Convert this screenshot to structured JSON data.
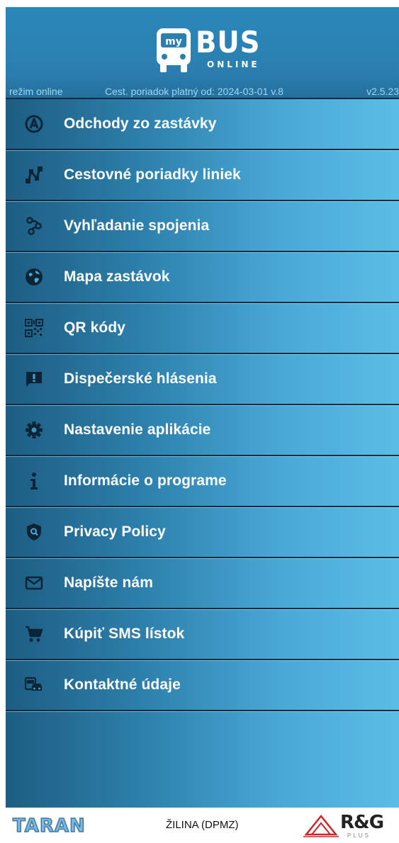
{
  "header": {
    "logo_word": "BUS",
    "logo_badge": "my",
    "logo_sub": "ONLINE",
    "mode": "režim online",
    "timetable_validity": "Cest. poriadok platný od: 2024-03-01 v.8",
    "version": "v2.5.23"
  },
  "menu": {
    "items": [
      {
        "label": "Odchody zo zastávky",
        "icon": "departure-a-icon"
      },
      {
        "label": "Cestovné poriadky liniek",
        "icon": "route-timetable-icon"
      },
      {
        "label": "Vyhľadanie spojenia",
        "icon": "connection-search-icon"
      },
      {
        "label": "Mapa zastávok",
        "icon": "globe-icon"
      },
      {
        "label": "QR kódy",
        "icon": "qr-code-icon"
      },
      {
        "label": "Dispečerské hlásenia",
        "icon": "alert-message-icon"
      },
      {
        "label": "Nastavenie aplikácie",
        "icon": "gear-icon"
      },
      {
        "label": "Informácie o programe",
        "icon": "info-icon"
      },
      {
        "label": "Privacy Policy",
        "icon": "shield-icon"
      },
      {
        "label": "Napíšte nám",
        "icon": "envelope-icon"
      },
      {
        "label": "Kúpiť SMS lístok",
        "icon": "cart-icon"
      },
      {
        "label": "Kontaktné údaje",
        "icon": "bus-car-icon"
      }
    ]
  },
  "footer": {
    "left_logo": "TARAN",
    "city": "ŽILINA (DPMZ)",
    "right_logo": "R&G",
    "right_logo_sub": "PLUS"
  },
  "colors": {
    "gradient_dark": "#1d5d83",
    "gradient_light": "#5bbde6",
    "divider": "#0e2c40",
    "icon": "#0b2436",
    "text": "#ffffff"
  }
}
